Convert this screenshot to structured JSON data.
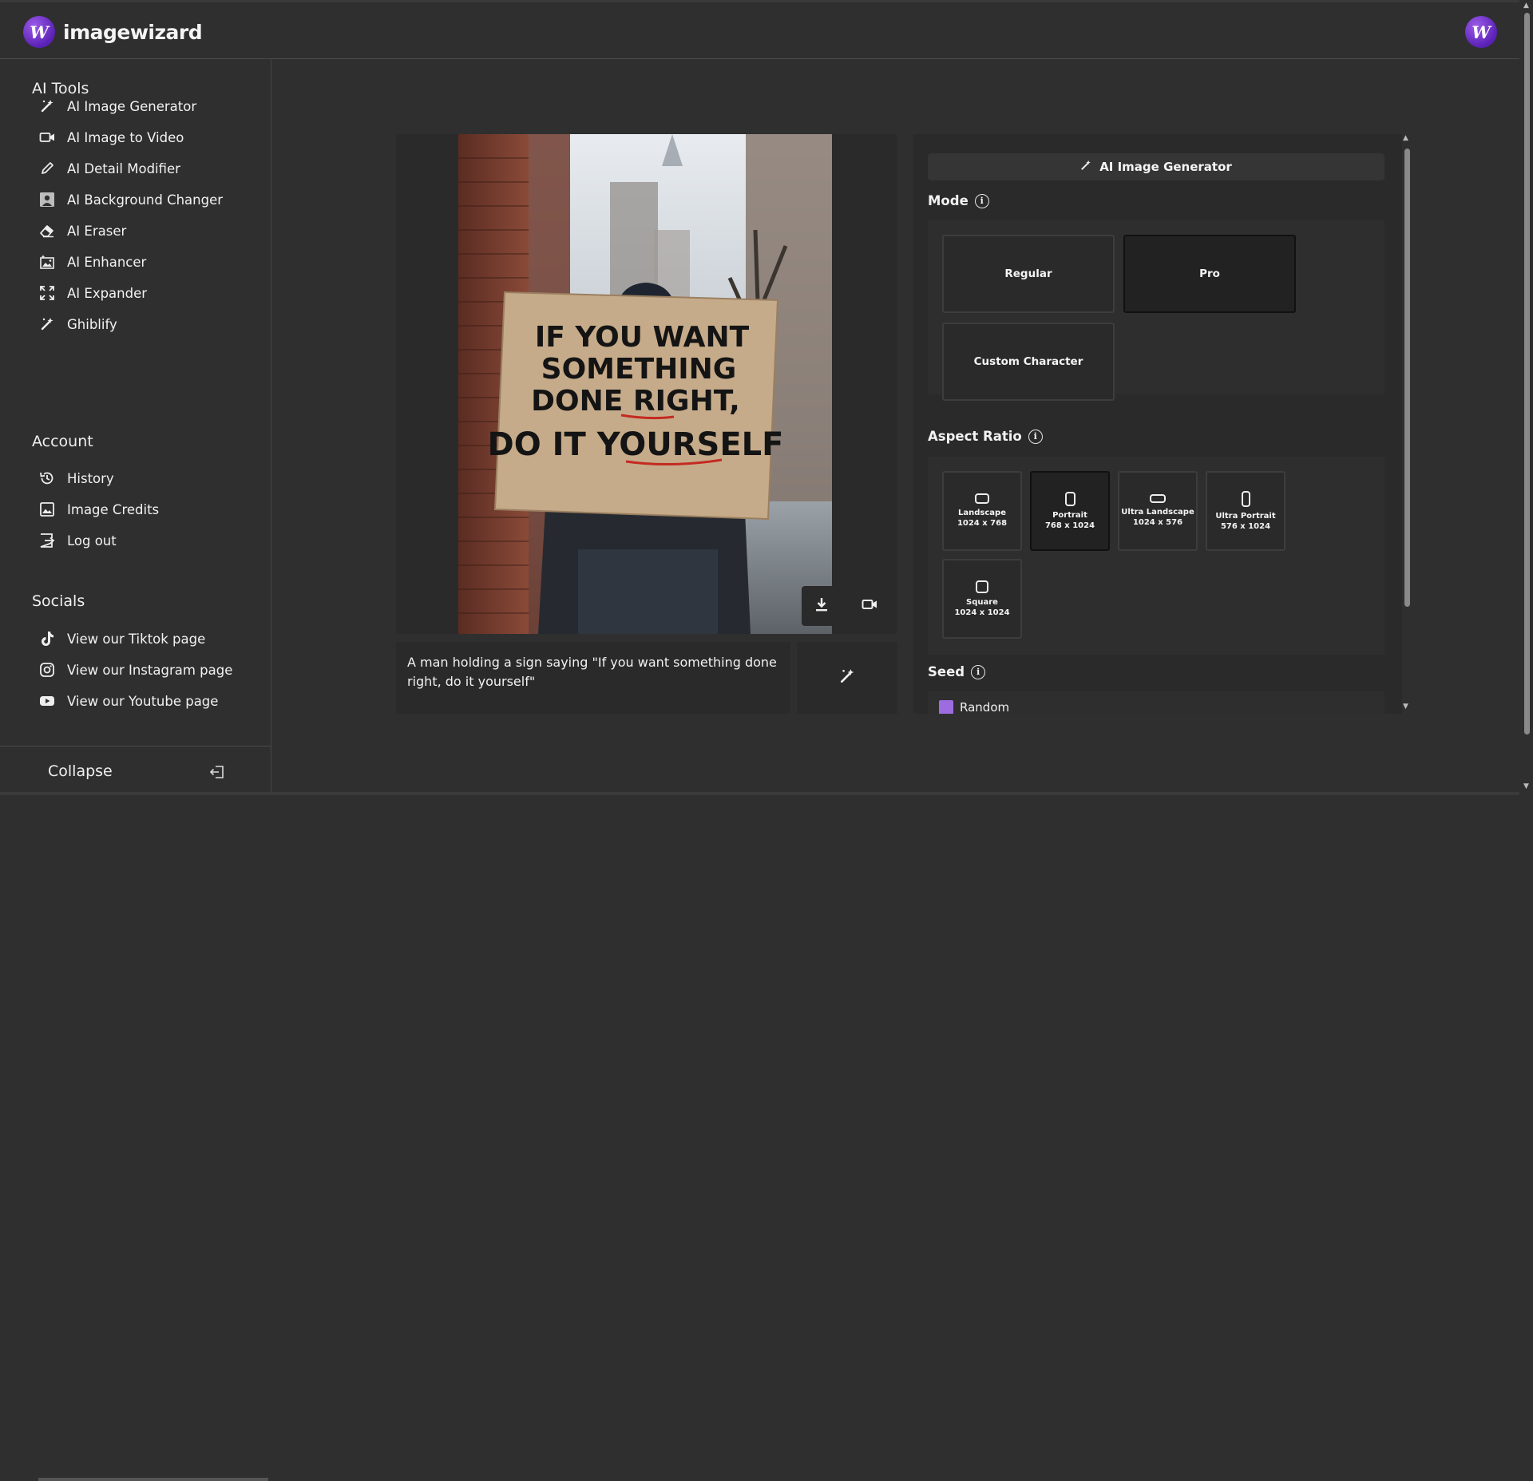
{
  "app": {
    "name": "imagewizard",
    "logo_letter": "W",
    "avatar_letter": "W"
  },
  "sidebar": {
    "sections": [
      {
        "title": "AI Tools"
      },
      {
        "title": "Account"
      },
      {
        "title": "Socials"
      }
    ],
    "tools": [
      {
        "label": "AI Image Generator",
        "icon": "magic-wand-icon"
      },
      {
        "label": "AI Image to Video",
        "icon": "video-camera-icon"
      },
      {
        "label": "AI Detail Modifier",
        "icon": "pencil-icon"
      },
      {
        "label": "AI Background Changer",
        "icon": "person-portrait-icon"
      },
      {
        "label": "AI Eraser",
        "icon": "eraser-icon"
      },
      {
        "label": "AI Enhancer",
        "icon": "image-enhance-icon"
      },
      {
        "label": "AI Expander",
        "icon": "expand-icon"
      },
      {
        "label": "Ghiblify",
        "icon": "magic-wand-icon"
      }
    ],
    "account": [
      {
        "label": "History",
        "icon": "history-icon"
      },
      {
        "label": "Image Credits",
        "icon": "image-icon"
      },
      {
        "label": "Log out",
        "icon": "logout-icon"
      }
    ],
    "socials": [
      {
        "label": "View our Tiktok page",
        "icon": "tiktok-icon"
      },
      {
        "label": "View our Instagram page",
        "icon": "instagram-icon"
      },
      {
        "label": "View our Youtube page",
        "icon": "youtube-icon"
      }
    ],
    "collapse_label": "Collapse"
  },
  "image": {
    "sign_lines": [
      "IF YOU WANT",
      "SOMETHING",
      "DONE RIGHT,",
      "DO IT YOURSELF"
    ]
  },
  "prompt": {
    "text": "A man holding a sign saying \"If you want something done right, do it yourself\""
  },
  "settings": {
    "header": "AI Image Generator",
    "mode_label": "Mode",
    "modes": [
      {
        "label": "Regular",
        "active": false
      },
      {
        "label": "Pro",
        "active": true
      },
      {
        "label": "Custom Character",
        "active": false
      }
    ],
    "aspect_label": "Aspect Ratio",
    "ratios": [
      {
        "name": "Landscape",
        "size": "1024 x 768",
        "active": false
      },
      {
        "name": "Portrait",
        "size": "768 x 1024",
        "active": true
      },
      {
        "name": "Ultra Landscape",
        "size": "1024 x 576",
        "active": false
      },
      {
        "name": "Ultra Portrait",
        "size": "576 x 1024",
        "active": false
      },
      {
        "name": "Square",
        "size": "1024 x 1024",
        "active": false
      }
    ],
    "seed_label": "Seed",
    "seed_option": "Random",
    "info_glyph": "i"
  },
  "colors": {
    "accent": "#9c6ce0",
    "background": "#2f2f2f",
    "panel": "#2a2a2a"
  }
}
